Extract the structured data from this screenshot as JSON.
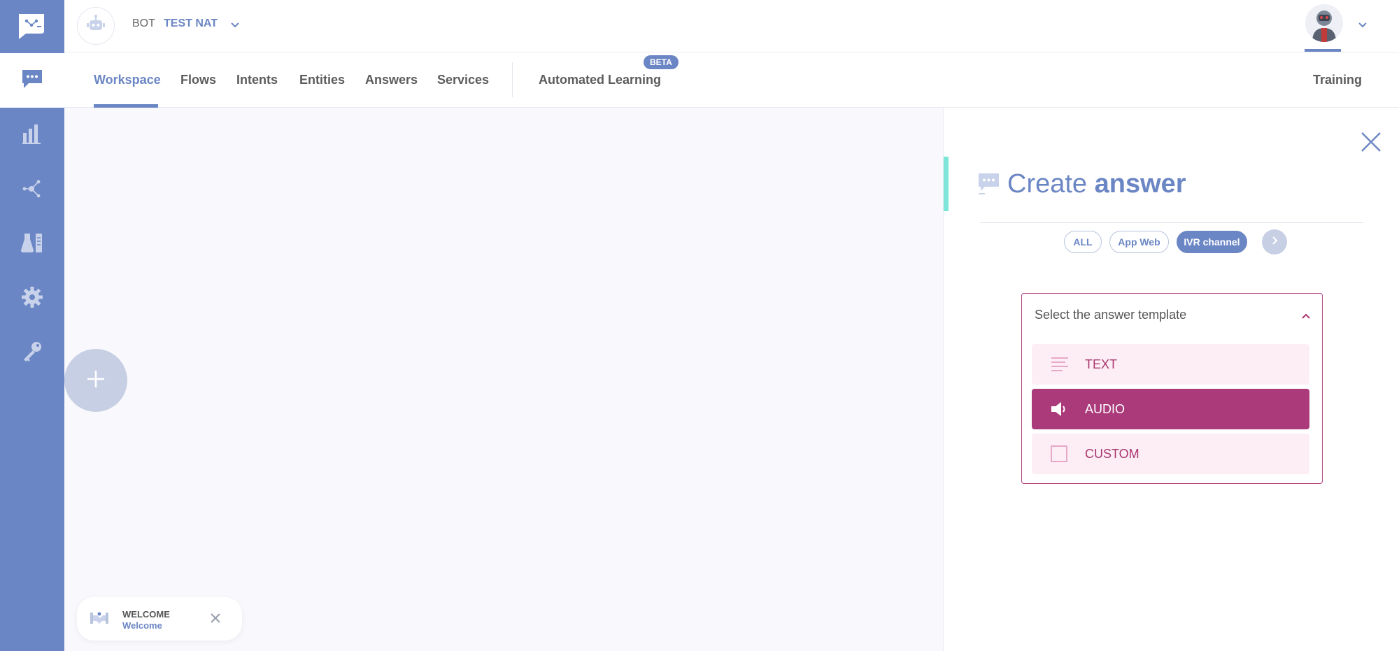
{
  "header": {
    "bot_label": "BOT",
    "bot_name": "TEST NAT"
  },
  "nav": {
    "tabs": [
      {
        "label": "Workspace"
      },
      {
        "label": "Flows"
      },
      {
        "label": "Intents"
      },
      {
        "label": "Entities"
      },
      {
        "label": "Answers"
      },
      {
        "label": "Services"
      },
      {
        "label": "Automated Learning"
      },
      {
        "label": "Training"
      }
    ],
    "beta_badge": "BETA",
    "active_tab": "Workspace"
  },
  "sidebar": {
    "items": [
      {
        "icon": "chat-bubble-icon",
        "active": true
      },
      {
        "icon": "bar-chart-icon",
        "active": false
      },
      {
        "icon": "network-icon",
        "active": false
      },
      {
        "icon": "lab-flask-icon",
        "active": false
      },
      {
        "icon": "gear-icon",
        "active": false
      },
      {
        "icon": "key-icon",
        "active": false
      }
    ]
  },
  "canvas": {
    "welcome_card": {
      "title": "WELCOME",
      "subtitle": "Welcome"
    }
  },
  "panel": {
    "title_light": "Create ",
    "title_bold": "answer",
    "channels": [
      {
        "label": "ALL",
        "selected": false
      },
      {
        "label": "App Web",
        "selected": false
      },
      {
        "label": "IVR channel",
        "selected": true
      }
    ],
    "template_select": {
      "placeholder": "Select the answer template",
      "options": [
        {
          "label": "TEXT",
          "icon": "text-lines-icon",
          "selected": false
        },
        {
          "label": "AUDIO",
          "icon": "speaker-icon",
          "selected": true
        },
        {
          "label": "CUSTOM",
          "icon": "square-icon",
          "selected": false
        }
      ]
    }
  },
  "colors": {
    "primary": "#6b86c4",
    "accent_teal": "#7ee6d8",
    "magenta": "#ab3a7b",
    "magenta_light": "#fdeef6"
  }
}
